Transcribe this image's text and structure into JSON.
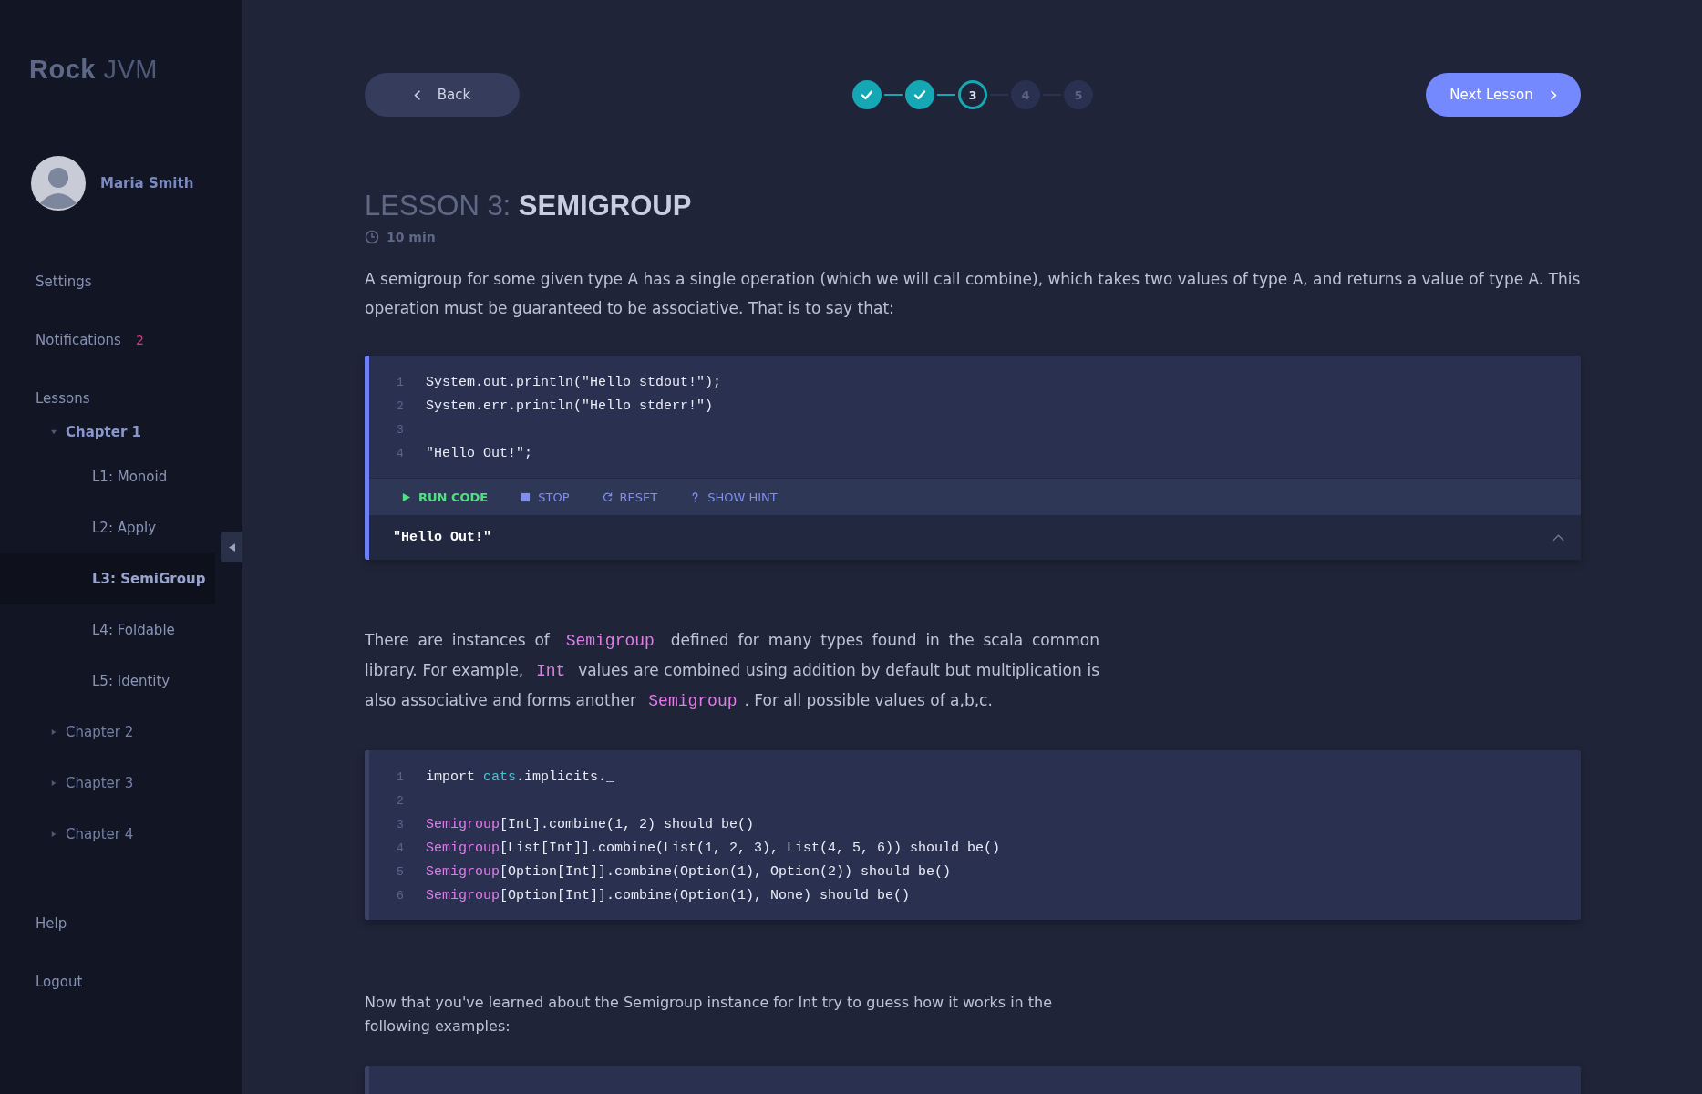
{
  "sidebar": {
    "brand": {
      "bold": "Rock",
      "light": "JVM"
    },
    "user": {
      "name": "Maria Smith"
    },
    "menu": [
      {
        "label": "Settings"
      },
      {
        "label": "Notifications",
        "badge": "2"
      }
    ],
    "lessons": {
      "label": "Lessons",
      "chapters": [
        {
          "label": "Chapter 1",
          "expanded": true,
          "children": [
            {
              "label": "L1: Monoid",
              "selected": false
            },
            {
              "label": "L2: Apply",
              "selected": false
            },
            {
              "label": "L3: SemiGroup",
              "selected": true
            },
            {
              "label": "L4: Foldable",
              "selected": false
            },
            {
              "label": "L5: Identity",
              "selected": false
            }
          ]
        },
        {
          "label": "Chapter 2",
          "expanded": false
        },
        {
          "label": "Chapter 3",
          "expanded": false
        },
        {
          "label": "Chapter 4",
          "expanded": false
        }
      ]
    },
    "footer": [
      {
        "label": "Help"
      },
      {
        "label": "Logout"
      }
    ]
  },
  "topbar": {
    "back": "Back",
    "next": "Next Lesson",
    "steps": [
      {
        "completed": true,
        "current": false
      },
      {
        "completed": true,
        "current": false
      },
      {
        "completed": false,
        "current": true,
        "label": "3"
      },
      {
        "completed": false,
        "current": false,
        "label": "4"
      },
      {
        "completed": false,
        "current": false,
        "label": "5"
      }
    ]
  },
  "lesson": {
    "prefix": "LESSON 3:",
    "title": "SEMIGROUP",
    "duration": "10 min"
  },
  "content": [
    {
      "kind": "paragraph",
      "narrow": false,
      "small": false,
      "parts": [
        {
          "kind": "text",
          "text": "A semigroup for some given type A has a single operation (which we will call combine), which takes two values of type A, and returns a value of type A. This operation must be guaranteed to be associative.  That is to say that:"
        }
      ]
    },
    {
      "kind": "code",
      "active": true,
      "lines": [
        {
          "number": "1",
          "tokens": [
            {
              "kind": "plain",
              "text": "System.out.println(\"Hello stdout!\");"
            }
          ]
        },
        {
          "number": "2",
          "tokens": [
            {
              "kind": "plain",
              "text": "System.err.println(\"Hello stderr!\")"
            }
          ]
        },
        {
          "number": "3"
        },
        {
          "number": "4",
          "tokens": [
            {
              "kind": "plain",
              "text": "\"Hello Out!\";"
            }
          ]
        }
      ],
      "actions": [
        {
          "kind": "run",
          "label": "RUN CODE"
        },
        {
          "kind": "stop",
          "label": "STOP"
        },
        {
          "kind": "reset",
          "label": "RESET"
        },
        {
          "kind": "hint",
          "label": "SHOW HINT"
        }
      ],
      "output": "\"Hello Out!\""
    },
    {
      "kind": "paragraph",
      "narrow": true,
      "small": false,
      "parts": [
        {
          "kind": "text",
          "text": "There are instances of "
        },
        {
          "kind": "code",
          "text": "Semigroup"
        },
        {
          "kind": "text",
          "text": " defined for many types found in the scala common library. For example, "
        },
        {
          "kind": "code",
          "text": "Int"
        },
        {
          "kind": "text",
          "text": " values are combined using addition by default but multiplication is also associative and forms another "
        },
        {
          "kind": "code",
          "text": "Semigroup"
        },
        {
          "kind": "text",
          "text": ". For all possible values of a,b,c."
        }
      ]
    },
    {
      "kind": "code",
      "active": false,
      "lines": [
        {
          "number": "1",
          "tokens": [
            {
              "kind": "plain",
              "text": "import "
            },
            {
              "kind": "package",
              "text": "cats"
            },
            {
              "kind": "plain",
              "text": ".implicits._"
            }
          ]
        },
        {
          "number": "2"
        },
        {
          "number": "3",
          "tokens": [
            {
              "kind": "type",
              "text": "Semigroup"
            },
            {
              "kind": "plain",
              "text": "[Int].combine(1, 2) should be()"
            }
          ]
        },
        {
          "number": "4",
          "tokens": [
            {
              "kind": "type",
              "text": "Semigroup"
            },
            {
              "kind": "plain",
              "text": "[List[Int]].combine(List(1, 2, 3), List(4, 5, 6)) should be()"
            }
          ]
        },
        {
          "number": "5",
          "tokens": [
            {
              "kind": "type",
              "text": "Semigroup"
            },
            {
              "kind": "plain",
              "text": "[Option[Int]].combine(Option(1), Option(2)) should be()"
            }
          ]
        },
        {
          "number": "6",
          "tokens": [
            {
              "kind": "type",
              "text": "Semigroup"
            },
            {
              "kind": "plain",
              "text": "[Option[Int]].combine(Option(1), None) should be()"
            }
          ]
        }
      ]
    },
    {
      "kind": "paragraph",
      "narrow": true,
      "small": true,
      "parts": [
        {
          "kind": "text",
          "text": "Now that you've learned about the Semigroup instance for Int try to guess how it works in the following examples:"
        }
      ]
    },
    {
      "kind": "code",
      "active": false
    }
  ]
}
